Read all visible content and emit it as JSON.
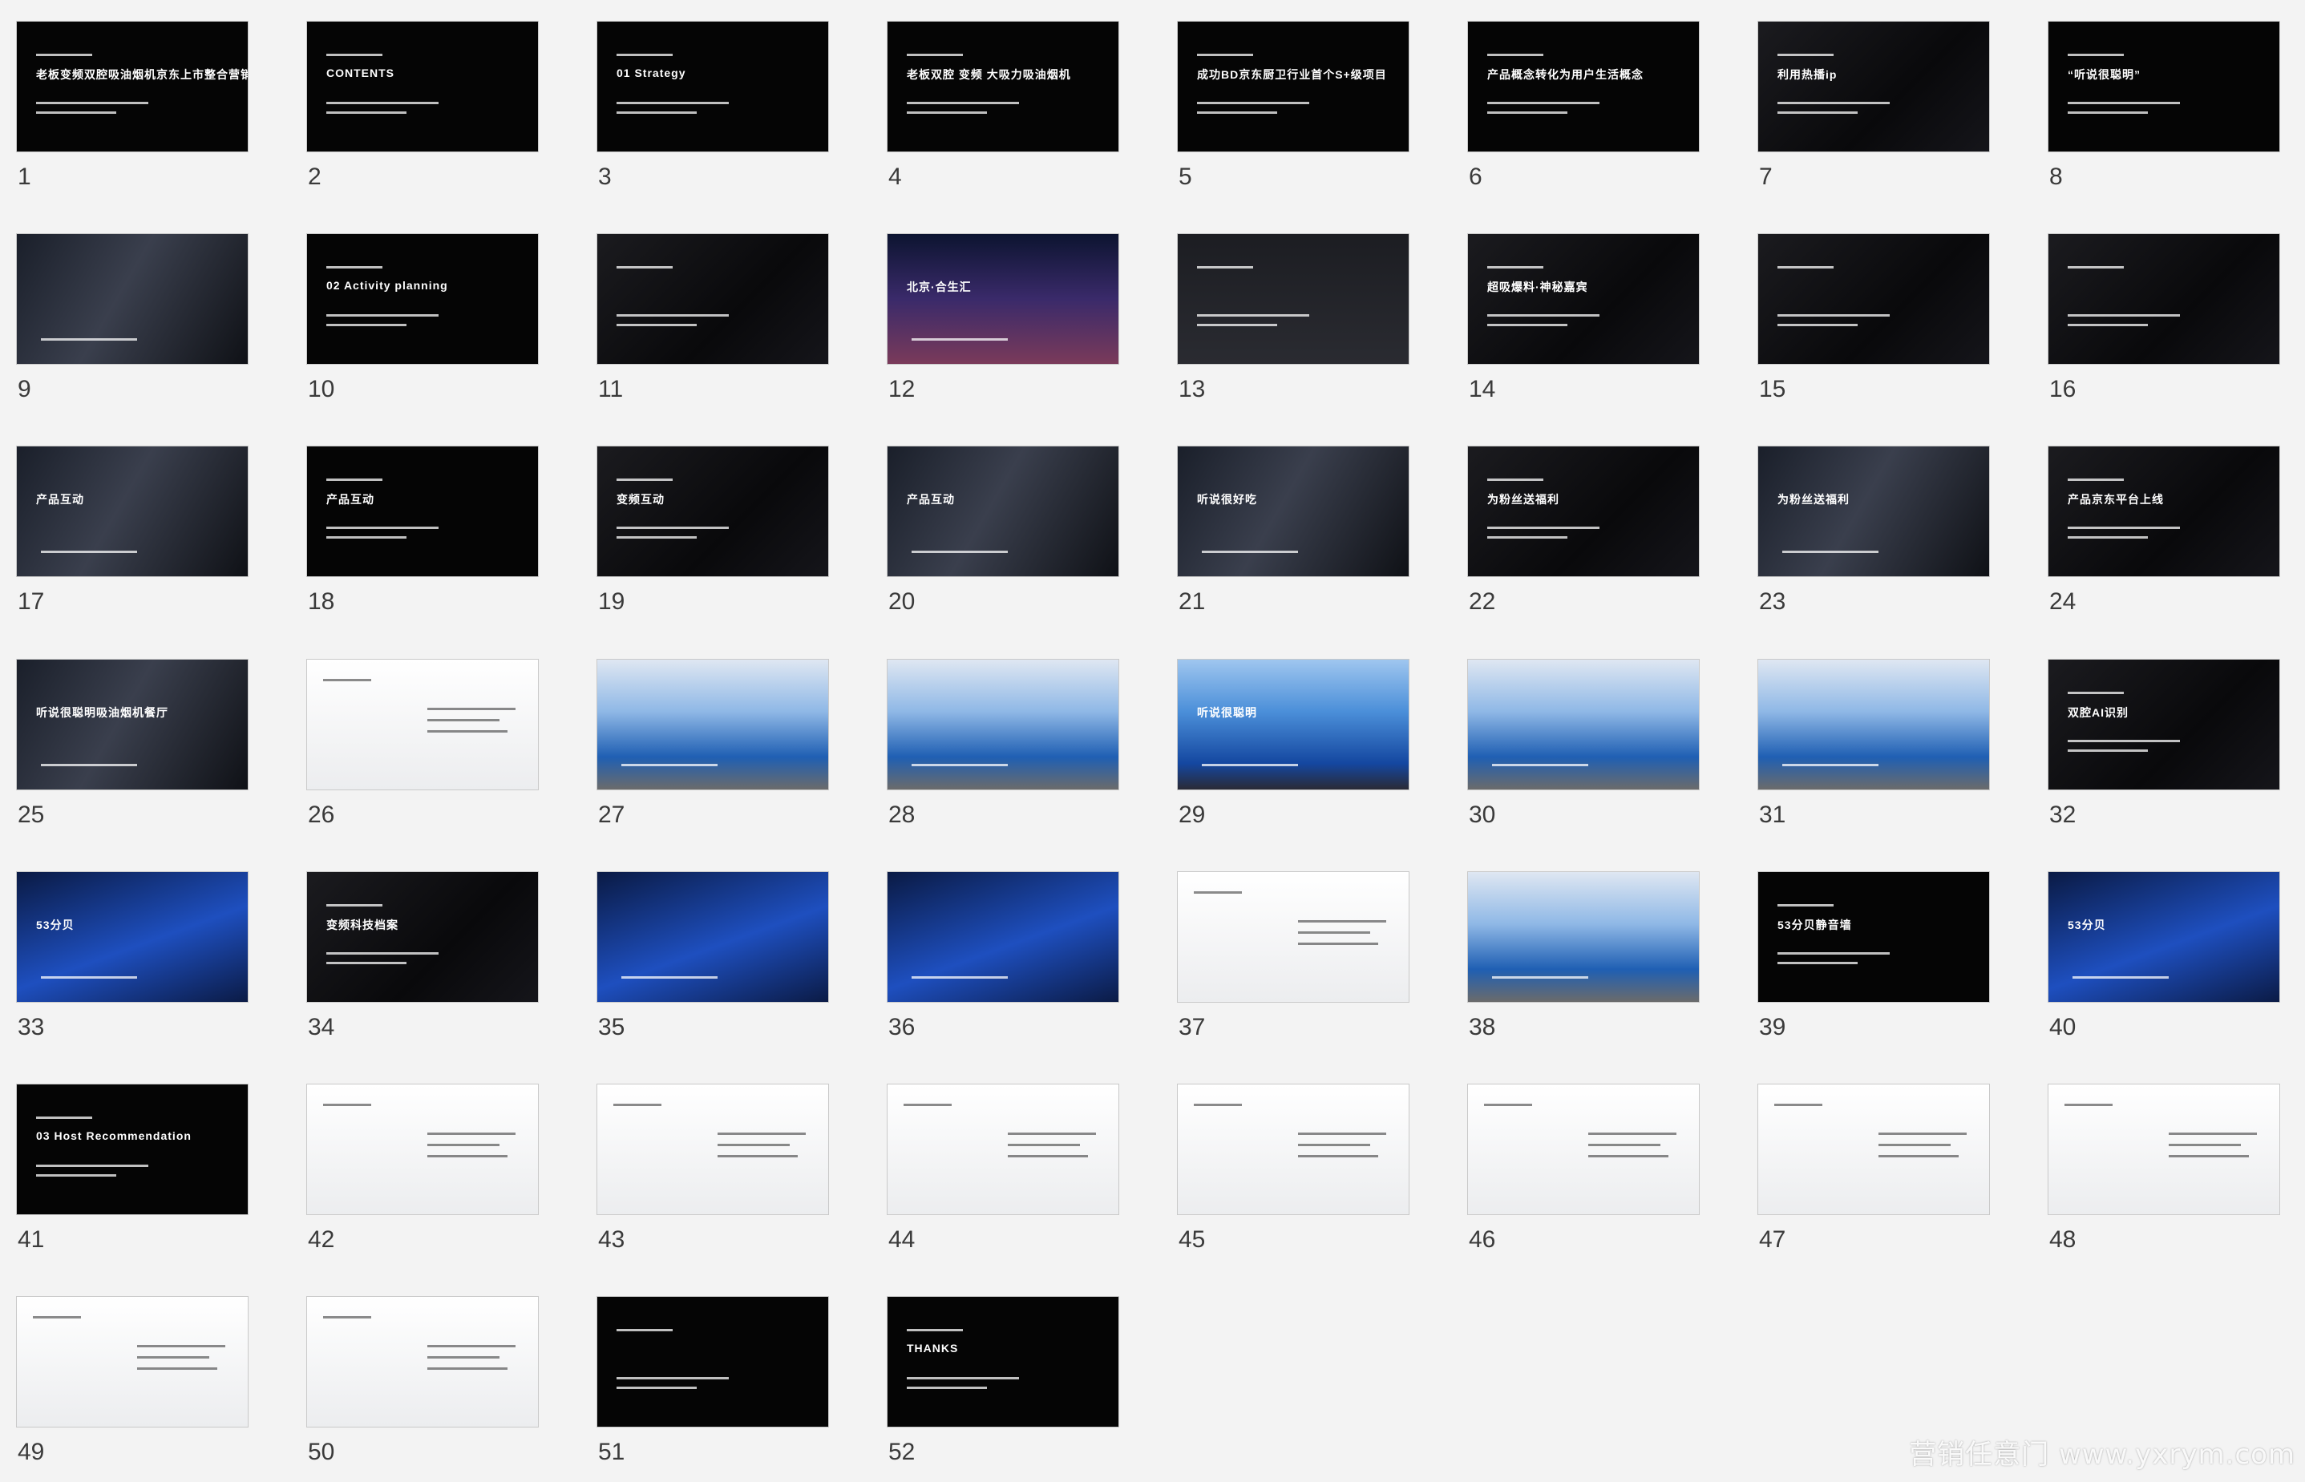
{
  "slides": [
    {
      "number": "1",
      "theme": "black",
      "label": "老板变频双腔吸油烟机京东上市整合营销方案"
    },
    {
      "number": "2",
      "theme": "black",
      "label": "CONTENTS"
    },
    {
      "number": "3",
      "theme": "black",
      "label": "01 Strategy"
    },
    {
      "number": "4",
      "theme": "black",
      "label": "老板双腔 变频 大吸力吸油烟机"
    },
    {
      "number": "5",
      "theme": "black",
      "label": "成功BD京东厨卫行业首个S+级项目"
    },
    {
      "number": "6",
      "theme": "black",
      "label": "产品概念转化为用户生活概念"
    },
    {
      "number": "7",
      "theme": "dark",
      "label": "利用热播ip"
    },
    {
      "number": "8",
      "theme": "black",
      "label": "“听说很聪明”"
    },
    {
      "number": "9",
      "theme": "photo",
      "label": ""
    },
    {
      "number": "10",
      "theme": "black",
      "label": "02 Activity planning"
    },
    {
      "number": "11",
      "theme": "dark",
      "label": ""
    },
    {
      "number": "12",
      "theme": "city",
      "label": "北京·合生汇"
    },
    {
      "number": "13",
      "theme": "grey",
      "label": ""
    },
    {
      "number": "14",
      "theme": "dark",
      "label": "超吸爆料·神秘嘉宾"
    },
    {
      "number": "15",
      "theme": "dark",
      "label": ""
    },
    {
      "number": "16",
      "theme": "dark",
      "label": ""
    },
    {
      "number": "17",
      "theme": "photo",
      "label": "产品互动"
    },
    {
      "number": "18",
      "theme": "black",
      "label": "产品互动"
    },
    {
      "number": "19",
      "theme": "dark",
      "label": "变频互动"
    },
    {
      "number": "20",
      "theme": "photo",
      "label": "产品互动"
    },
    {
      "number": "21",
      "theme": "photo",
      "label": "听说很好吃"
    },
    {
      "number": "22",
      "theme": "dark",
      "label": "为粉丝送福利"
    },
    {
      "number": "23",
      "theme": "photo",
      "label": "为粉丝送福利"
    },
    {
      "number": "24",
      "theme": "dark",
      "label": "产品京东平台上线"
    },
    {
      "number": "25",
      "theme": "photo",
      "label": "听说很聪明吸油烟机餐厅"
    },
    {
      "number": "26",
      "theme": "white",
      "label": ""
    },
    {
      "number": "27",
      "theme": "stage",
      "label": ""
    },
    {
      "number": "28",
      "theme": "stage",
      "label": ""
    },
    {
      "number": "29",
      "theme": "stage2",
      "label": "听说很聪明"
    },
    {
      "number": "30",
      "theme": "stage",
      "label": ""
    },
    {
      "number": "31",
      "theme": "stage",
      "label": ""
    },
    {
      "number": "32",
      "theme": "dark",
      "label": "双腔AI识别"
    },
    {
      "number": "33",
      "theme": "blue",
      "label": "53分贝"
    },
    {
      "number": "34",
      "theme": "dark",
      "label": "变频科技档案"
    },
    {
      "number": "35",
      "theme": "blue",
      "label": ""
    },
    {
      "number": "36",
      "theme": "blue",
      "label": ""
    },
    {
      "number": "37",
      "theme": "white",
      "label": ""
    },
    {
      "number": "38",
      "theme": "stage",
      "label": ""
    },
    {
      "number": "39",
      "theme": "black",
      "label": "53分贝静音墙"
    },
    {
      "number": "40",
      "theme": "blue",
      "label": "53分贝"
    },
    {
      "number": "41",
      "theme": "black",
      "label": "03 Host Recommendation"
    },
    {
      "number": "42",
      "theme": "white",
      "label": ""
    },
    {
      "number": "43",
      "theme": "white",
      "label": ""
    },
    {
      "number": "44",
      "theme": "white",
      "label": ""
    },
    {
      "number": "45",
      "theme": "white",
      "label": ""
    },
    {
      "number": "46",
      "theme": "white",
      "label": ""
    },
    {
      "number": "47",
      "theme": "white",
      "label": ""
    },
    {
      "number": "48",
      "theme": "white",
      "label": ""
    },
    {
      "number": "49",
      "theme": "white",
      "label": ""
    },
    {
      "number": "50",
      "theme": "white",
      "label": ""
    },
    {
      "number": "51",
      "theme": "black",
      "label": ""
    },
    {
      "number": "52",
      "theme": "black",
      "label": "THANKS"
    }
  ],
  "watermark": "营销任意门 www.yxrym.com"
}
